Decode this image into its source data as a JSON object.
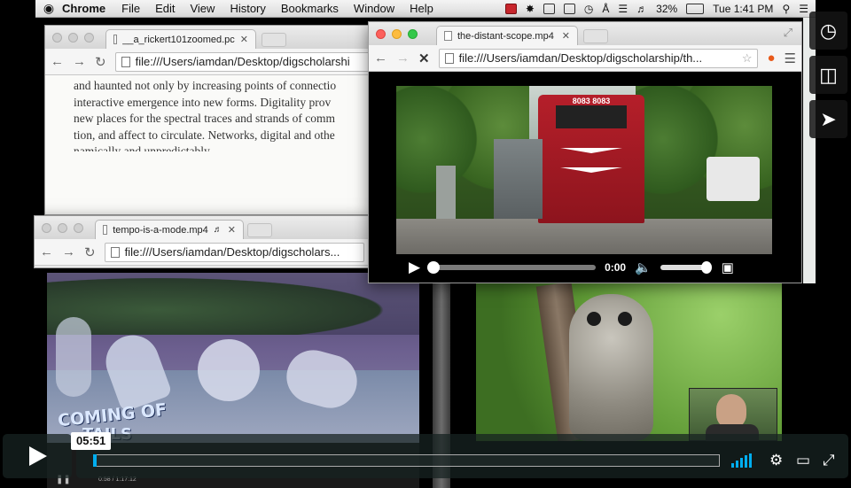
{
  "menubar": {
    "apple": "",
    "app": "Chrome",
    "items": [
      "File",
      "Edit",
      "View",
      "History",
      "Bookmarks",
      "Window",
      "Help"
    ],
    "battery": "32%",
    "clock": "Tue 1:41 PM"
  },
  "window1": {
    "tab_title": "__a_rickert101zoomed.pc",
    "url": "file:///Users/iamdan/Desktop/digscholarshi",
    "lines": [
      "and haunted not only by increasing points of connectio",
      "interactive emergence into new forms. Digitality prov",
      "new places for the spectral traces and strands of comm",
      "tion, and affect to circulate. Networks, digital and othe",
      "namically and unpredictably..."
    ]
  },
  "window2": {
    "tab_title": "tempo-is-a-mode.mp4",
    "url": "file:///Users/iamdan/Desktop/digscholars..."
  },
  "window3": {
    "tab_title": "the-distant-scope.mp4",
    "url": "file:///Users/iamdan/Desktop/digscholarship/th...",
    "video_time": "0:00",
    "train_number": "8083 8083"
  },
  "left_video": {
    "caption_line1": "COMING OF",
    "caption_line2": "TAILS",
    "progress_text": "0:58 / 1:17:12"
  },
  "right_rail": {
    "icons": [
      "clock-icon",
      "layers-icon",
      "send-icon"
    ]
  },
  "player": {
    "time": "05:51",
    "progress": 0.005,
    "accent": "#00adef"
  }
}
